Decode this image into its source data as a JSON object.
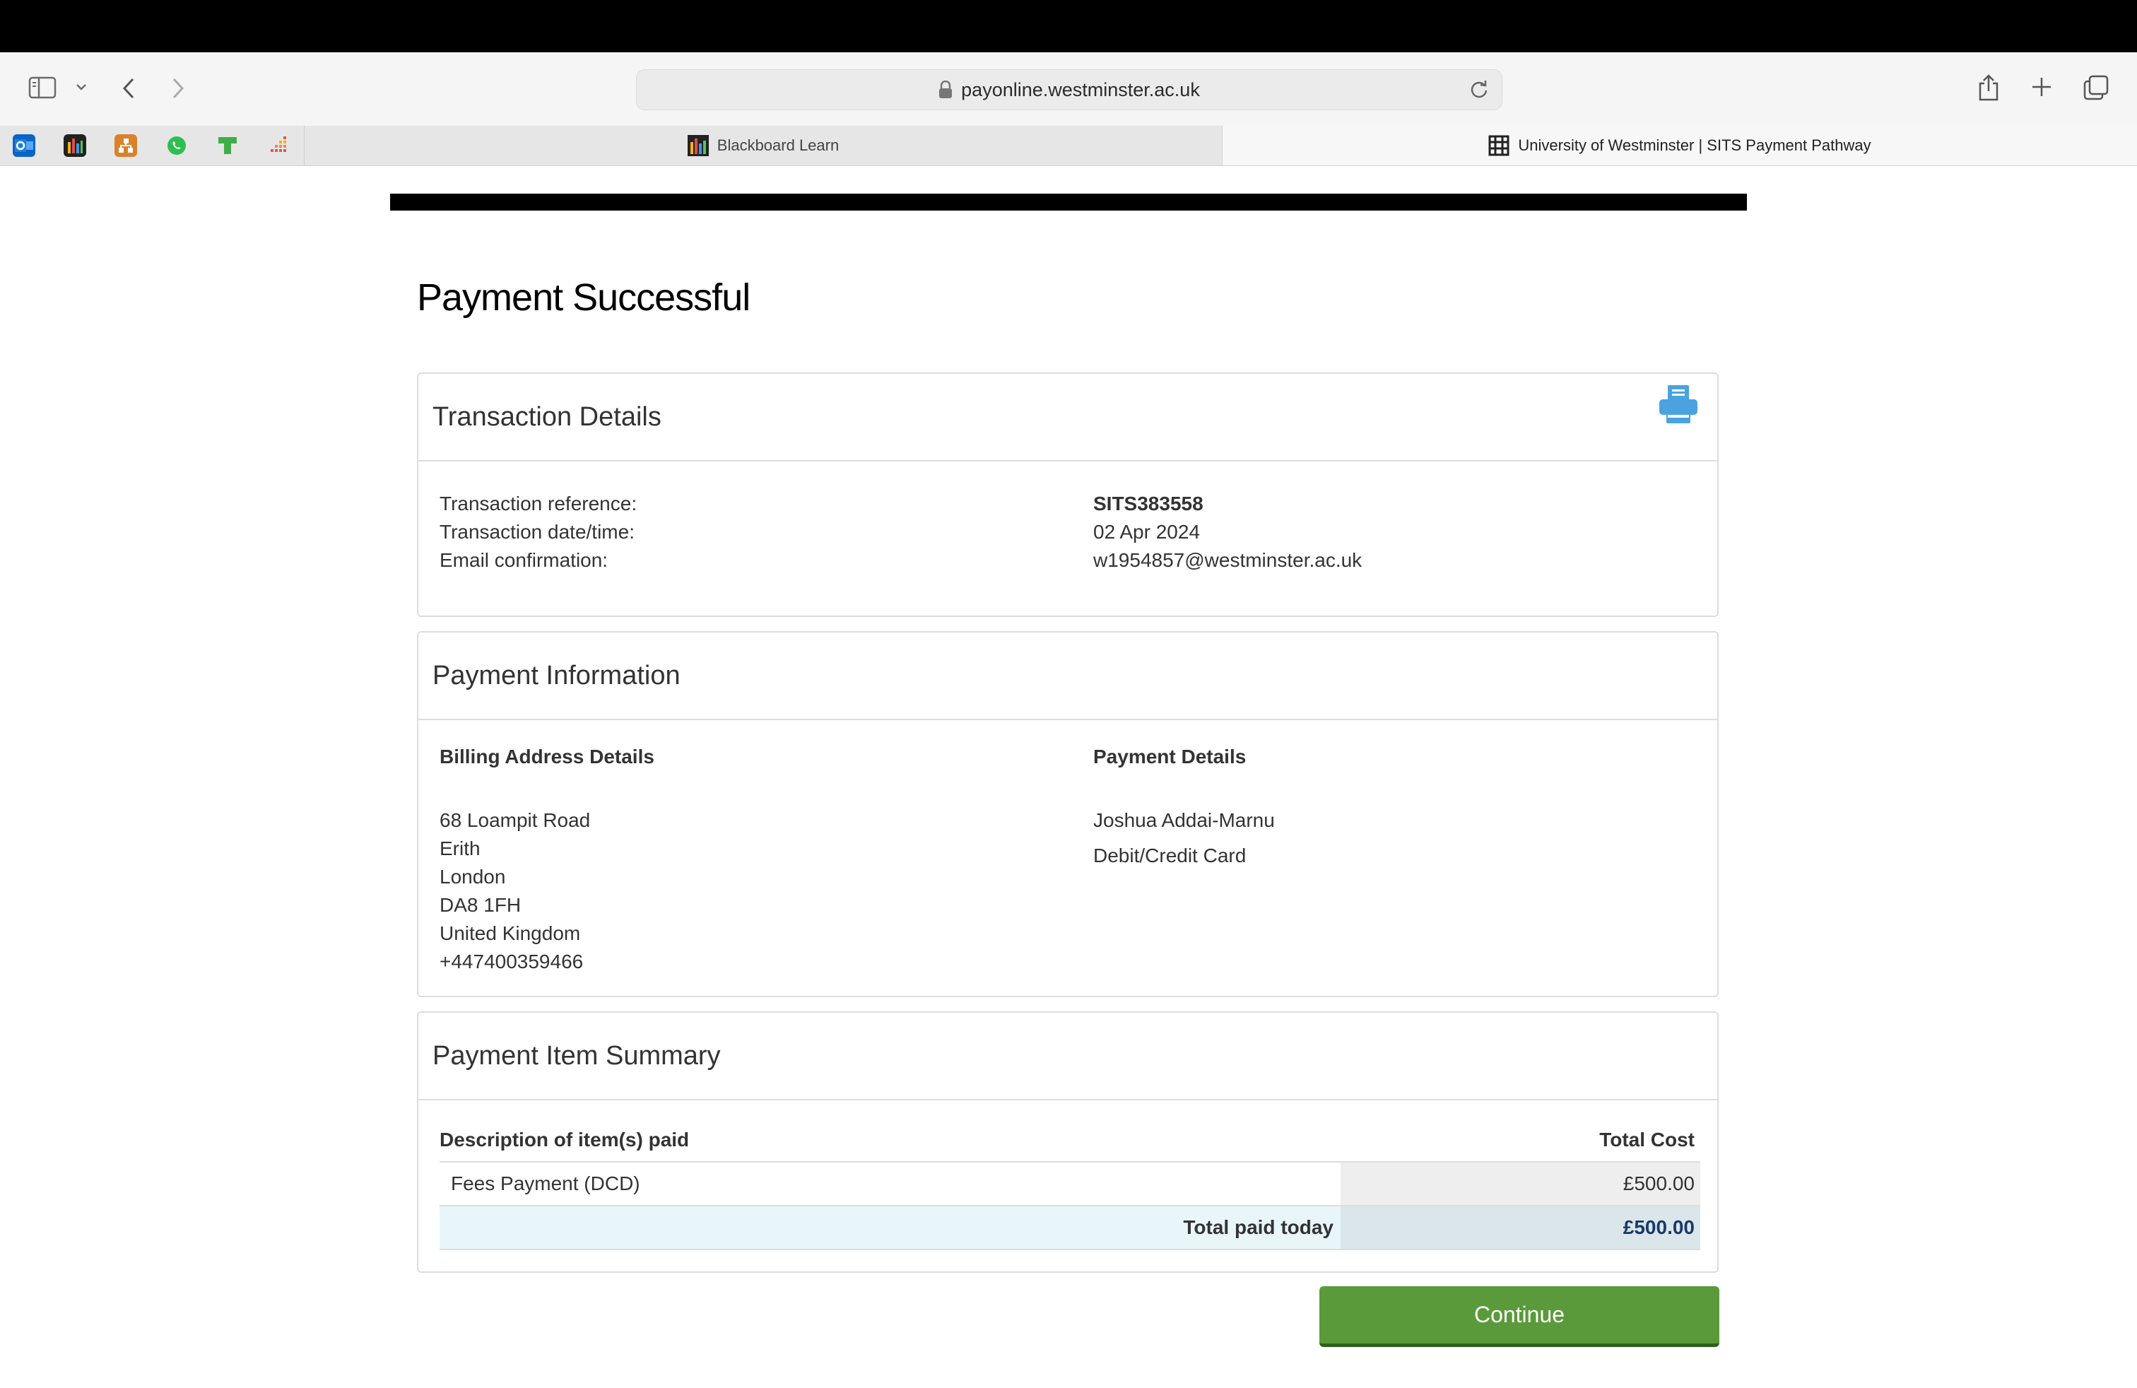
{
  "browser": {
    "url": "payonline.westminster.ac.uk",
    "tabs": [
      {
        "label": "Blackboard Learn",
        "active": false
      },
      {
        "label": "University of Westminster | SITS Payment Pathway",
        "active": true
      }
    ],
    "favorites": [
      "outlook-icon",
      "chart-bars-icon",
      "network-icon",
      "whatsapp-icon",
      "green-block-icon",
      "dots-chart-icon"
    ]
  },
  "page": {
    "title": "Payment Successful"
  },
  "transaction": {
    "heading": "Transaction Details",
    "reference_label": "Transaction reference:",
    "reference_value": "SITS383558",
    "datetime_label": "Transaction date/time:",
    "datetime_value": "02 Apr 2024",
    "email_label": "Email confirmation:",
    "email_value": "w1954857@westminster.ac.uk"
  },
  "payment_info": {
    "heading": "Payment Information",
    "billing_heading": "Billing Address Details",
    "billing_lines": [
      "68 Loampit Road",
      "Erith",
      "London",
      "DA8 1FH",
      "United Kingdom",
      "+447400359466"
    ],
    "details_heading": "Payment Details",
    "payer_name": "Joshua Addai-Marnu",
    "method": "Debit/Credit Card"
  },
  "summary": {
    "heading": "Payment Item Summary",
    "col_description": "Description of item(s) paid",
    "col_cost": "Total Cost",
    "items": [
      {
        "description": "Fees Payment (DCD)",
        "cost": "£500.00"
      }
    ],
    "total_label": "Total paid today",
    "total_value": "£500.00"
  },
  "actions": {
    "continue_label": "Continue"
  },
  "colors": {
    "continue_bg": "#5a9a3a",
    "printer_icon": "#4aa3df",
    "total_value": "#1a3a6a"
  }
}
